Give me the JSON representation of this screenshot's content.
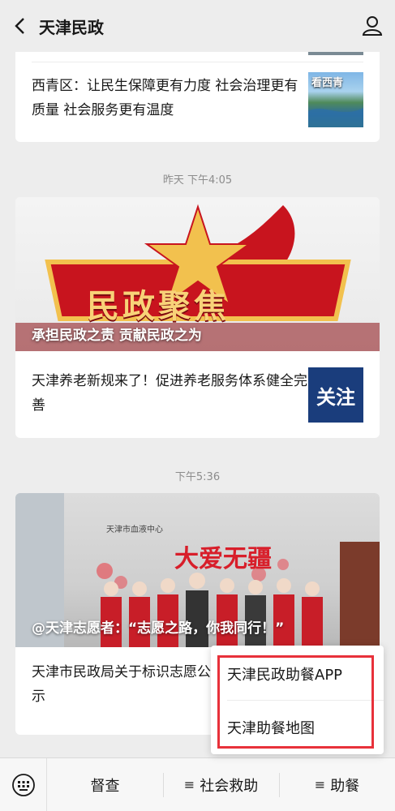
{
  "header": {
    "title": "天津民政"
  },
  "feed": [
    {
      "article": "西青区：让民生保障更有力度 社会治理更有质量 社会服务更有温度",
      "thumb_text": "看西青"
    },
    {
      "time": "昨天 下午4:05",
      "hero_caption": "承担民政之责 贡献民政之为",
      "hero_banner": "民政聚焦",
      "article": "天津养老新规来了！促进养老服务体系健全完善",
      "thumb_text": "关注"
    },
    {
      "time": "下午5:36",
      "hero_caption": "@天津志愿者：“志愿之路，你我同行！”",
      "hero_sign": "天津市血液中心",
      "hero_wall": "大爱无疆",
      "article": "天津市民政局关于标识志愿公示"
    }
  ],
  "popup": {
    "items": [
      "天津民政助餐APP",
      "天津助餐地图"
    ]
  },
  "bottom_menu": [
    "督查",
    "社会救助",
    "助餐"
  ],
  "colors": {
    "highlight": "#e8313a",
    "banner_red": "#c8141e",
    "banner_gold": "#f2c14e"
  }
}
